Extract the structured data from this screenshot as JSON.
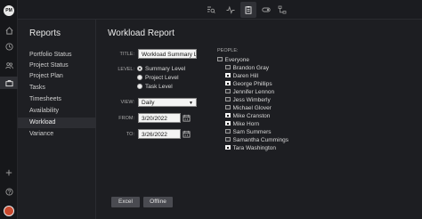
{
  "rail": {
    "logo": "PM",
    "icons": [
      "home-icon",
      "clock-icon",
      "team-icon",
      "briefcase-icon",
      "plus-icon",
      "help-icon"
    ]
  },
  "toolbar": {
    "icons": [
      "search-list-icon",
      "activity-icon",
      "clipboard-icon",
      "toggle-icon",
      "flow-icon"
    ]
  },
  "reports": {
    "title": "Reports",
    "items": [
      "Portfolio Status",
      "Project Status",
      "Project Plan",
      "Tasks",
      "Timesheets",
      "Availability",
      "Workload",
      "Variance"
    ],
    "active": "Workload"
  },
  "form": {
    "heading": "Workload Report",
    "title_label": "TITLE:",
    "title_value": "Workload Summary L",
    "level_label": "LEVEL:",
    "levels": [
      "Summary Level",
      "Project Level",
      "Task Level"
    ],
    "level_selected": "Summary Level",
    "view_label": "VIEW:",
    "view_value": "Daily",
    "from_label": "FROM:",
    "from_value": "3/20/2022",
    "to_label": "TO:",
    "to_value": "3/26/2022",
    "people_label": "PEOPLE:",
    "people": [
      {
        "name": "Everyone",
        "checked": false
      },
      {
        "name": "Brandon Gray",
        "checked": false
      },
      {
        "name": "Daren Hill",
        "checked": true
      },
      {
        "name": "George Phillips",
        "checked": true
      },
      {
        "name": "Jennifer Lennon",
        "checked": false
      },
      {
        "name": "Jess Wimberly",
        "checked": false
      },
      {
        "name": "Michael Glover",
        "checked": false
      },
      {
        "name": "Mike Cranston",
        "checked": true
      },
      {
        "name": "Mike Horn",
        "checked": true
      },
      {
        "name": "Sam Summers",
        "checked": false
      },
      {
        "name": "Samantha Cummings",
        "checked": false
      },
      {
        "name": "Tara Washington",
        "checked": true
      }
    ]
  },
  "buttons": {
    "excel": "Excel",
    "offline": "Offline"
  }
}
